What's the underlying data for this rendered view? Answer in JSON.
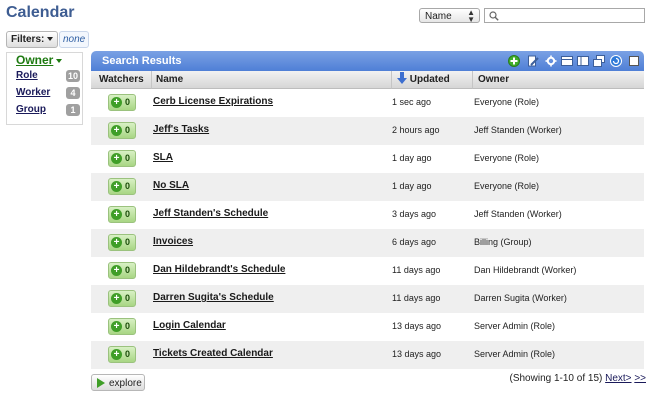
{
  "page": {
    "title": "Calendar"
  },
  "sort_select": {
    "value": "Name"
  },
  "search": {
    "value": "",
    "icon": "search-icon"
  },
  "filters": {
    "label": "Filters:",
    "value": "none"
  },
  "facets": {
    "title": "Owner",
    "items": [
      {
        "label": "Role",
        "count": "10"
      },
      {
        "label": "Worker",
        "count": "4"
      },
      {
        "label": "Group",
        "count": "1"
      }
    ]
  },
  "results": {
    "title": "Search Results",
    "toolbar_icons": [
      "add-icon",
      "edit-icon",
      "gear-icon",
      "list-icon",
      "copy-icon",
      "subtotals-icon",
      "refresh-icon",
      "select-all-checkbox"
    ],
    "columns": {
      "watchers": "Watchers",
      "name": "Name",
      "updated": "Updated",
      "owner": "Owner"
    },
    "sort_icon": "sort-down-icon",
    "rows": [
      {
        "watchers": "0",
        "name": "Cerb License Expirations",
        "updated": "1 sec ago",
        "owner": "Everyone (Role)"
      },
      {
        "watchers": "0",
        "name": "Jeff's Tasks",
        "updated": "2 hours ago",
        "owner": "Jeff Standen (Worker)"
      },
      {
        "watchers": "0",
        "name": "SLA",
        "updated": "1 day ago",
        "owner": "Everyone (Role)"
      },
      {
        "watchers": "0",
        "name": "No SLA",
        "updated": "1 day ago",
        "owner": "Everyone (Role)"
      },
      {
        "watchers": "0",
        "name": "Jeff Standen's Schedule",
        "updated": "3 days ago",
        "owner": "Jeff Standen (Worker)"
      },
      {
        "watchers": "0",
        "name": "Invoices",
        "updated": "6 days ago",
        "owner": "Billing (Group)"
      },
      {
        "watchers": "0",
        "name": "Dan Hildebrandt's Schedule",
        "updated": "11 days ago",
        "owner": "Dan Hildebrandt (Worker)"
      },
      {
        "watchers": "0",
        "name": "Darren Sugita's Schedule",
        "updated": "11 days ago",
        "owner": "Darren Sugita (Worker)"
      },
      {
        "watchers": "0",
        "name": "Login Calendar",
        "updated": "13 days ago",
        "owner": "Server Admin (Role)"
      },
      {
        "watchers": "0",
        "name": "Tickets Created Calendar",
        "updated": "13 days ago",
        "owner": "Server Admin (Role)"
      }
    ]
  },
  "footer": {
    "explore_label": "explore",
    "pager_text": "(Showing 1-10 of 15)",
    "next_label": "Next>",
    "last_label": ">>"
  }
}
